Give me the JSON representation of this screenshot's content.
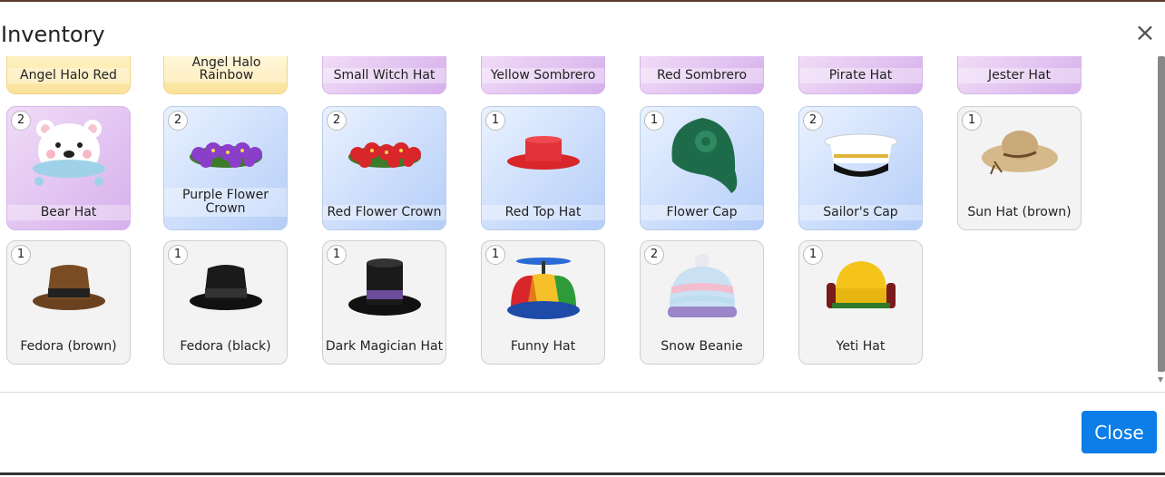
{
  "dialog": {
    "title": "Inventory",
    "close_label": "Close",
    "close_x": "×"
  },
  "top_row": [
    {
      "label": "Angel Halo Red",
      "style": "gold"
    },
    {
      "label": "Angel Halo Rainbow",
      "style": "gold"
    },
    {
      "label": "Small Witch Hat",
      "style": "purple"
    },
    {
      "label": "Yellow Sombrero",
      "style": "purple"
    },
    {
      "label": "Red Sombrero",
      "style": "purple"
    },
    {
      "label": "Pirate Hat",
      "style": "purple"
    },
    {
      "label": "Jester Hat",
      "style": "purple"
    }
  ],
  "row2": [
    {
      "label": "Bear Hat",
      "count": "2",
      "style": "purple",
      "icon": "bear-hat-icon"
    },
    {
      "label": "Purple Flower Crown",
      "count": "2",
      "style": "blue",
      "icon": "purple-flower-crown-icon"
    },
    {
      "label": "Red Flower Crown",
      "count": "2",
      "style": "blue",
      "icon": "red-flower-crown-icon"
    },
    {
      "label": "Red Top Hat",
      "count": "1",
      "style": "blue",
      "icon": "red-top-hat-icon"
    },
    {
      "label": "Flower Cap",
      "count": "1",
      "style": "blue",
      "icon": "flower-cap-icon"
    },
    {
      "label": "Sailor's Cap",
      "count": "2",
      "style": "blue",
      "icon": "sailor-cap-icon"
    },
    {
      "label": "Sun Hat (brown)",
      "count": "1",
      "style": "grey",
      "icon": "sun-hat-icon"
    }
  ],
  "row3": [
    {
      "label": "Fedora (brown)",
      "count": "1",
      "style": "grey",
      "icon": "fedora-brown-icon"
    },
    {
      "label": "Fedora (black)",
      "count": "1",
      "style": "grey",
      "icon": "fedora-black-icon"
    },
    {
      "label": "Dark Magician Hat",
      "count": "1",
      "style": "grey",
      "icon": "dark-magician-hat-icon"
    },
    {
      "label": "Funny Hat",
      "count": "1",
      "style": "grey",
      "icon": "funny-hat-icon"
    },
    {
      "label": "Snow Beanie",
      "count": "2",
      "style": "grey",
      "icon": "snow-beanie-icon"
    },
    {
      "label": "Yeti Hat",
      "count": "1",
      "style": "grey",
      "icon": "yeti-hat-icon"
    }
  ]
}
